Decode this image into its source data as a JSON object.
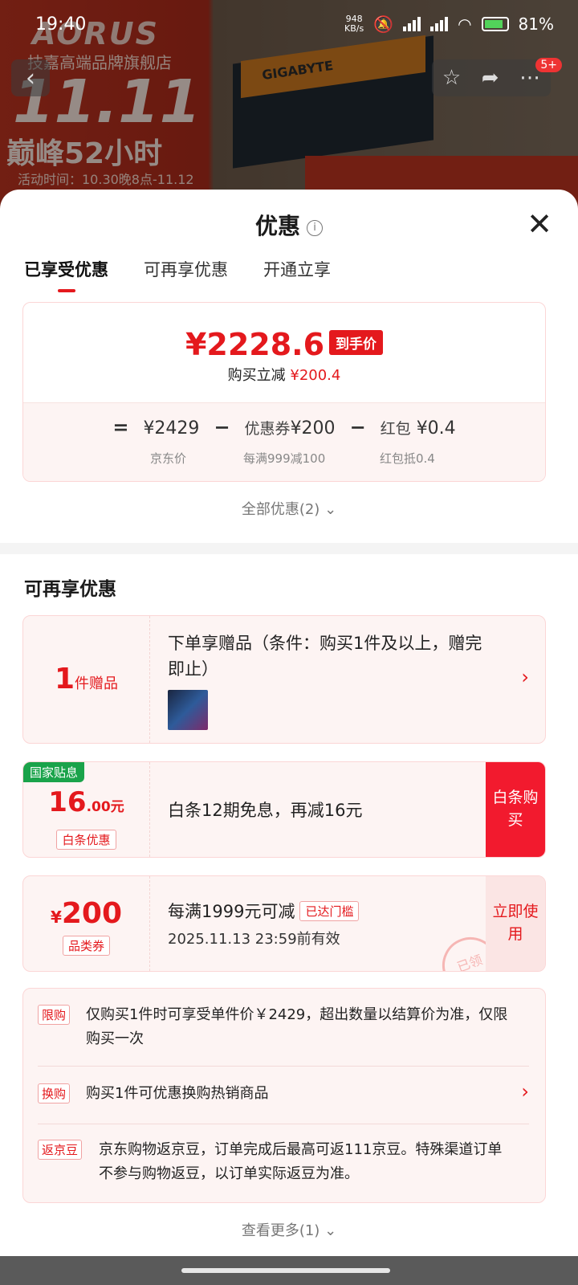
{
  "status_bar": {
    "time": "19:40",
    "net_speed": "948",
    "net_speed_unit": "KB/s",
    "battery": "81%"
  },
  "background": {
    "brand": "AORUS",
    "store_name": "技嘉高端品牌旗舰店",
    "event": "11.11",
    "event_sub": "巅峰52小时",
    "event_time": "活动时间：10.30晚8点-11.12",
    "product_label": "GIGABYTE",
    "badge_count": "5+"
  },
  "sheet": {
    "title": "优惠",
    "tabs": [
      "已享受优惠",
      "可再享优惠",
      "开通立享"
    ],
    "final_price": "¥2228.6",
    "final_price_tag": "到手价",
    "instant_discount_label": "购买立减",
    "instant_discount_value": "¥200.4",
    "breakdown": {
      "eq": "=",
      "jd_price": "¥2429",
      "minus": "−",
      "coupon_label": "优惠券",
      "coupon_value": "¥200",
      "redpack_label": "红包",
      "redpack_value": "¥0.4",
      "jd_price_caption": "京东价",
      "coupon_caption": "每满999减100",
      "redpack_caption": "红包抵0.4"
    },
    "all_offers": "全部优惠(2)",
    "more_section_title": "可再享优惠",
    "gift": {
      "count": "1",
      "unit": "件赠品",
      "text": "下单享赠品（条件：购买1件及以上，赠完即止）"
    },
    "subsidy": {
      "badge": "国家贴息",
      "amount": "16",
      "amount_decimal": ".00元",
      "pill": "白条优惠",
      "text": "白条12期免息，再减16元",
      "action": "白条购买"
    },
    "coupon": {
      "currency": "¥",
      "amount": "200",
      "pill": "品类券",
      "title": "每满1999元可减",
      "threshold_pill": "已达门槛",
      "valid": "2025.11.13 23:59前有效",
      "action": "立即使用",
      "stamp": "已领"
    },
    "rules": [
      {
        "tag": "限购",
        "text": "仅购买1件时可享受单件价￥2429，超出数量以结算价为准，仅限购买一次"
      },
      {
        "tag": "换购",
        "text": "购买1件可优惠换购热销商品"
      },
      {
        "tag": "返京豆",
        "text": "京东购物返京豆，订单完成后最高可返111京豆。特殊渠道订单不参与购物返豆，以订单实际返豆为准。"
      }
    ],
    "see_more": "查看更多(1)"
  }
}
